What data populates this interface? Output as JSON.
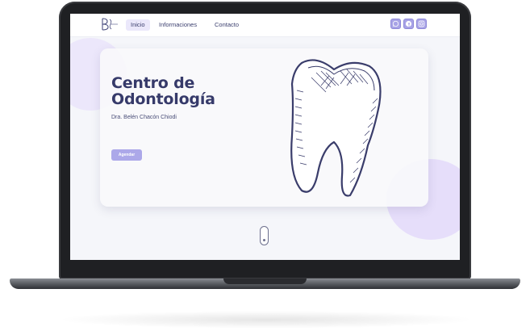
{
  "nav": {
    "links": [
      {
        "label": "Inicio"
      },
      {
        "label": "Informaciones"
      },
      {
        "label": "Contacto"
      }
    ],
    "social_icons": [
      "whatsapp-icon",
      "facebook-icon",
      "instagram-icon"
    ]
  },
  "hero": {
    "title_line1": "Centro de",
    "title_line2": "Odontología",
    "subtitle": "Dra. Belén Chacón Chiodi",
    "cta_label": "Agendar",
    "image": "tooth-illustration"
  },
  "colors": {
    "accent": "#aca8e9",
    "title": "#363a6a",
    "blob": "#e6defa"
  }
}
